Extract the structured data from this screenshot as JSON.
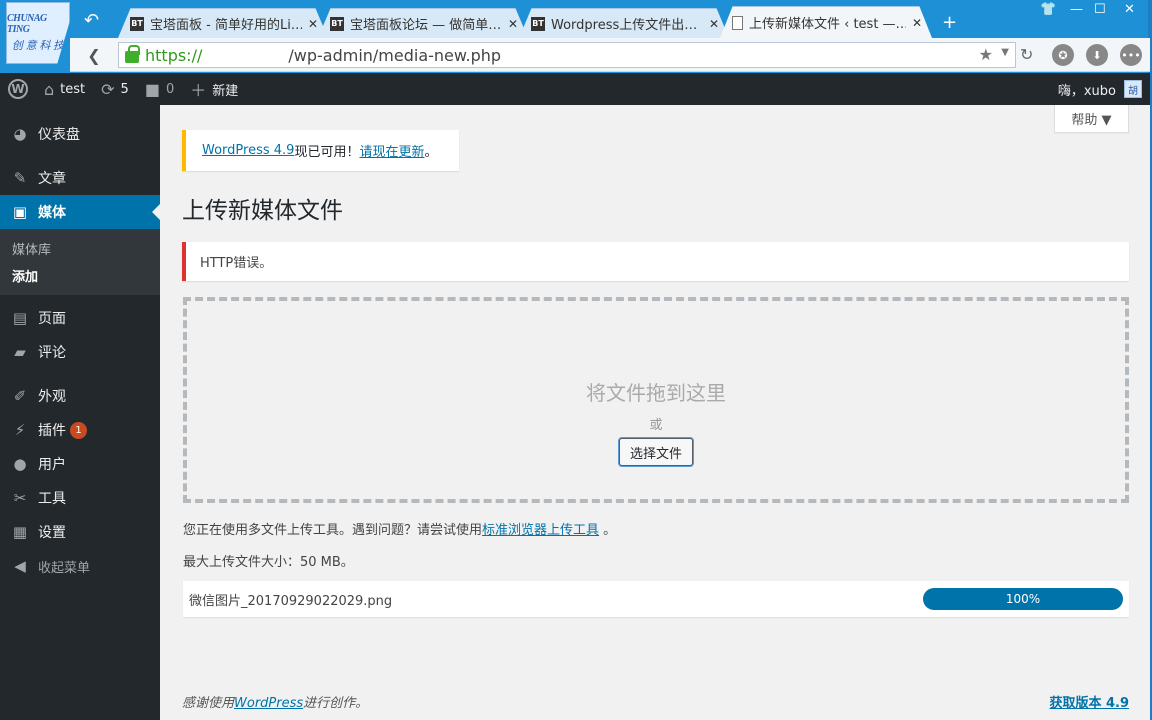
{
  "browser": {
    "logo_line1": "CHUNAG TING",
    "logo_line2": "创 意 科 技",
    "tabs": [
      {
        "favicon": "BT",
        "title": "宝塔面板 - 简单好用的Li…"
      },
      {
        "favicon": "BT",
        "title": "宝塔面板论坛 — 做简单…"
      },
      {
        "favicon": "BT",
        "title": "Wordpress上传文件出…"
      },
      {
        "favicon": "page-icon",
        "title": "上传新媒体文件 ‹ test —…"
      }
    ],
    "address": {
      "scheme": "https://",
      "path": "/wp-admin/media-new.php"
    }
  },
  "adminbar": {
    "site_name": "test",
    "updates_count": "5",
    "comments_count": "0",
    "new_label": "新建",
    "greeting": "嗨，xubo",
    "avatar_text": "胡"
  },
  "sidebar": {
    "items": [
      {
        "icon": "dashboard-icon",
        "label": "仪表盘"
      },
      {
        "icon": "pin-icon",
        "label": "文章"
      },
      {
        "icon": "media-icon",
        "label": "媒体"
      },
      {
        "icon": "page-icon",
        "label": "页面"
      },
      {
        "icon": "comment-icon",
        "label": "评论"
      },
      {
        "icon": "brush-icon",
        "label": "外观"
      },
      {
        "icon": "plugin-icon",
        "label": "插件",
        "badge": "1"
      },
      {
        "icon": "user-icon",
        "label": "用户"
      },
      {
        "icon": "wrench-icon",
        "label": "工具"
      },
      {
        "icon": "settings-icon",
        "label": "设置"
      },
      {
        "icon": "collapse-icon",
        "label": "收起菜单"
      }
    ],
    "submenu": [
      "媒体库",
      "添加"
    ]
  },
  "main": {
    "help_label": "帮助 ▼",
    "update_nag": {
      "link": "WordPress 4.9",
      "mid": "现已可用！",
      "action": "请现在更新",
      "end": "。"
    },
    "title": "上传新媒体文件",
    "error": "HTTP错误。",
    "drop_title": "将文件拖到这里",
    "drop_or": "或",
    "select_files": "选择文件",
    "uploader_note": {
      "text": "您正在使用多文件上传工具。遇到问题？请尝试使用",
      "link": "标准浏览器上传工具",
      "end": "。"
    },
    "max_size": "最大上传文件大小：50 MB。",
    "upload_item": {
      "filename": "微信图片_20170929022029.png",
      "progress": "100%"
    },
    "footer": {
      "pre": "感谢使用",
      "link": "WordPress",
      "post": "进行创作。",
      "version": "获取版本 4.9"
    }
  },
  "colors": {
    "accent": "#0073aa",
    "sidebar": "#23282d",
    "error": "#dc3232",
    "warning": "#ffb900",
    "badge": "#ca4a1f"
  }
}
